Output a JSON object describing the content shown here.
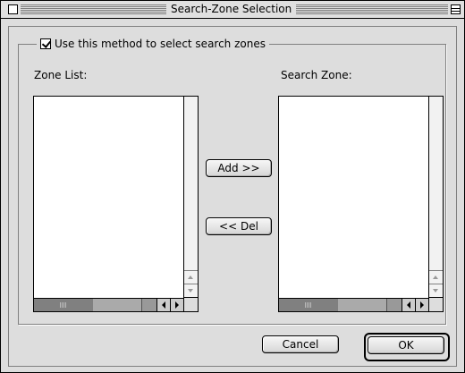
{
  "window": {
    "title": "Search-Zone Selection"
  },
  "group": {
    "checkbox_label": "Use this method to select search zones",
    "checked": true
  },
  "lists": {
    "zone_list_label": "Zone List:",
    "search_zone_label": "Search Zone:",
    "zone_list_items": [],
    "search_zone_items": []
  },
  "buttons": {
    "add": "Add >>",
    "del": "<< Del",
    "cancel": "Cancel",
    "ok": "OK"
  }
}
